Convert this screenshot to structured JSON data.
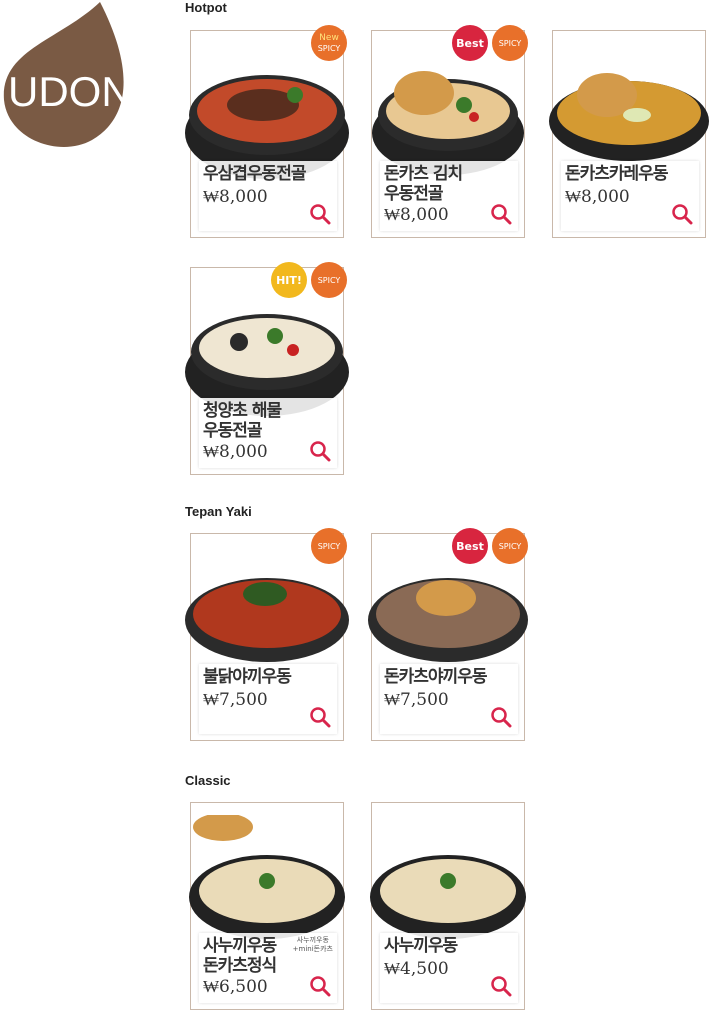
{
  "brand": {
    "logo_text": "UDON",
    "logo_color": "#7a5a44"
  },
  "sections": {
    "hotpot": {
      "title": "Hotpot"
    },
    "tepan": {
      "title": "Tepan Yaki"
    },
    "classic": {
      "title": "Classic"
    }
  },
  "items": {
    "i1": {
      "name": "우삼겹우동전골",
      "price": "₩8,000",
      "badges": [
        "New SPICY"
      ]
    },
    "i2": {
      "name": "돈카츠 김치\n우동전골",
      "price": "₩8,000",
      "badges": [
        "Best",
        "SPICY"
      ]
    },
    "i3": {
      "name": "돈카츠카레우동",
      "price": "₩8,000",
      "badges": []
    },
    "i4": {
      "name": "청양초 해물\n우동전골",
      "price": "₩8,000",
      "badges": [
        "HIT!",
        "SPICY"
      ]
    },
    "i5": {
      "name": "불닭야끼우동",
      "price": "₩7,500",
      "badges": [
        "SPICY"
      ]
    },
    "i6": {
      "name": "돈카츠야끼우동",
      "price": "₩7,500",
      "badges": [
        "Best",
        "SPICY"
      ]
    },
    "i7": {
      "name": "사누끼우동\n돈카츠정식",
      "price": "₩6,500",
      "subtext": "사누끼우동\n+mini돈카츠",
      "badges": []
    },
    "i8": {
      "name": "사누끼우동",
      "price": "₩4,500",
      "badges": []
    }
  },
  "badge_labels": {
    "new": "New",
    "spicy": "SPICY",
    "best": "Best",
    "hit": "HIT!"
  },
  "colors": {
    "badge_orange": "#e8702a",
    "badge_red": "#d8253f",
    "badge_yellow": "#f2b81d",
    "search_icon": "#d8254c"
  },
  "icons": {
    "search": "magnifier-icon"
  }
}
